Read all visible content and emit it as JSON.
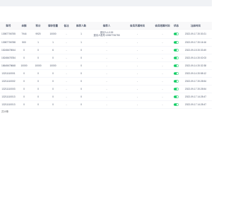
{
  "table": {
    "columns": [
      "账号",
      "余额",
      "积分",
      "储存容量",
      "备注",
      "推荐人数",
      "推荐人",
      "会员开通时间",
      "会员结算时间",
      "状态",
      "注册时间"
    ],
    "rows": [
      {
        "account": "13987706755",
        "balance": "7944",
        "points": "9920",
        "storage": "10000",
        "remark": "-",
        "referral_count": "1",
        "referrer": [
          "邀请人:LV.99",
          "邀请人账号:13987706755"
        ],
        "member_open_time": "-",
        "member_settle_time": "-",
        "status": true,
        "register_time": "2022-09-17 20:30:21"
      },
      {
        "account": "13987706788",
        "balance": "500",
        "points": "1",
        "storage": "1",
        "remark": "-",
        "referral_count": "1",
        "referrer": "-",
        "member_open_time": "-",
        "member_settle_time": "-",
        "status": true,
        "register_time": "2022-09-17 20:16:16"
      },
      {
        "account": "15245678944",
        "balance": "0",
        "points": "0",
        "storage": "6",
        "remark": "-",
        "referral_count": "0",
        "referrer": "-",
        "member_open_time": "-",
        "member_settle_time": "-",
        "status": true,
        "register_time": "2022-09-15 20:33:49"
      },
      {
        "account": "15245678784",
        "balance": "0",
        "points": "0",
        "storage": "0",
        "remark": "-",
        "referral_count": "0",
        "referrer": "-",
        "member_open_time": "-",
        "member_settle_time": "-",
        "status": true,
        "register_time": "2022-09-14 20:02:03"
      },
      {
        "account": "18645678668",
        "balance": "10000",
        "points": "10000",
        "storage": "10000",
        "remark": "-",
        "referral_count": "0",
        "referrer": "-",
        "member_open_time": "-",
        "member_settle_time": "-",
        "status": true,
        "register_time": "2022-09-14 20:32:38"
      },
      {
        "account": "13211110001",
        "balance": "0",
        "points": "0",
        "storage": "0",
        "remark": "-",
        "referral_count": "0",
        "referrer": "-",
        "member_open_time": "-",
        "member_settle_time": "-",
        "status": true,
        "register_time": "2022-09-14 20:58:12"
      },
      {
        "account": "13211110002",
        "balance": "0",
        "points": "0",
        "storage": "0",
        "remark": "-",
        "referral_count": "0",
        "referrer": "-",
        "member_open_time": "-",
        "member_settle_time": "-",
        "status": true,
        "register_time": "2022-09-17 20:28:54"
      },
      {
        "account": "13211110003",
        "balance": "0",
        "points": "0",
        "storage": "0",
        "remark": "-",
        "referral_count": "0",
        "referrer": "-",
        "member_open_time": "-",
        "member_settle_time": "-",
        "status": true,
        "register_time": "2022-09-17 20:28:54"
      },
      {
        "account": "13211110013",
        "balance": "0",
        "points": "0",
        "storage": "0",
        "remark": "-",
        "referral_count": "0",
        "referrer": "-",
        "member_open_time": "-",
        "member_settle_time": "-",
        "status": true,
        "register_time": "2022-09-17 14:28:47"
      },
      {
        "account": "13211110013",
        "balance": "0",
        "points": "0",
        "storage": "0",
        "remark": "-",
        "referral_count": "0",
        "referrer": "-",
        "member_open_time": "-",
        "member_settle_time": "-",
        "status": true,
        "register_time": "2022-09-17 14:28:47"
      }
    ]
  },
  "footer": {
    "total": "共10条"
  },
  "colors": {
    "switch_on": "#13ce66",
    "header_background": "#f8f8f9",
    "page_background": "#f0f2f5"
  }
}
